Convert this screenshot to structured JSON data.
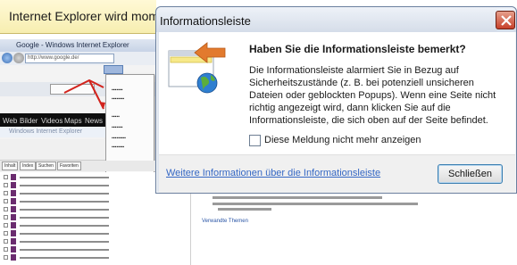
{
  "background": {
    "infobar_text": "Internet Explorer wird momentan",
    "window_title": "Google - Windows Internet Explorer",
    "address": "http://www.google.de/",
    "web_bar": [
      "Web",
      "Bilder",
      "Videos",
      "Maps",
      "News"
    ],
    "window_title2": "Windows Internet Explorer",
    "help_tabs": [
      "Inhalt",
      "Index",
      "Suchen",
      "Favoriten"
    ],
    "related_topics": "Verwandte Themen"
  },
  "dialog": {
    "title": "Informationsleiste",
    "heading": "Haben Sie die Informationsleiste bemerkt?",
    "body": "Die Informationsleiste alarmiert Sie in Bezug auf Sicherheitszustände (z. B. bei potenziell unsicheren Dateien oder geblockten Popups). Wenn eine Seite nicht richtig angezeigt wird, dann klicken Sie auf die Informationsleiste, die sich oben auf der Seite befindet.",
    "checkbox_label": "Diese Meldung nicht mehr anzeigen",
    "checkbox_checked": false,
    "more_info_link": "Weitere Informationen über die Informationsleiste",
    "close_button": "Schließen"
  },
  "colors": {
    "infobar": "#f7eeb0",
    "link": "#3467c4",
    "close_accent": "#c7412a",
    "arrow": "#e27a2e",
    "globe": "#2f7fd0"
  },
  "icons": {
    "illustration": "infobar-illustration-icon",
    "close": "close-icon",
    "shield": "shield-icon"
  }
}
